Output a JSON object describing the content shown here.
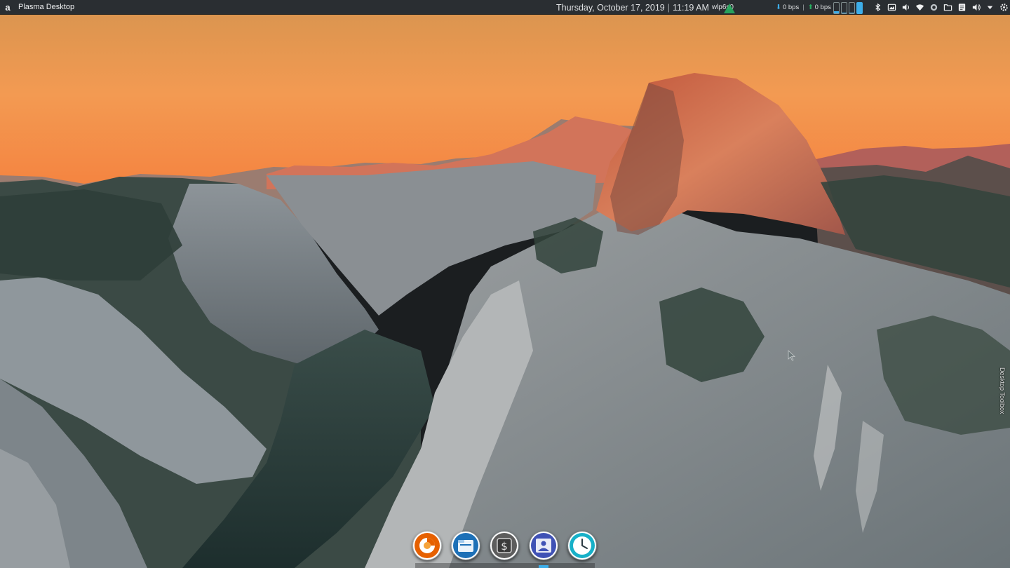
{
  "panel": {
    "launcher_icon": "a",
    "active_window_title": "Plasma Desktop",
    "date": "Thursday, October 17, 2019",
    "time": "11:19 AM",
    "network_name": "wlp6s0",
    "download_speed": "0 bps",
    "upload_speed": "0 bps",
    "tray_icons": [
      "bluetooth-icon",
      "screenshot-icon",
      "volume-icon",
      "wifi-icon",
      "updates-icon",
      "folder-icon",
      "notes-icon",
      "speaker-icon",
      "expand-tray-icon",
      "settings-icon"
    ]
  },
  "desktop": {
    "toolbox_label": "Desktop Toolbox"
  },
  "dock": {
    "apps": [
      {
        "name": "firefox-icon",
        "color": "#e66000"
      },
      {
        "name": "file-manager-icon",
        "color": "#1d70b7"
      },
      {
        "name": "terminal-icon",
        "color": "#5d5d5d"
      },
      {
        "name": "image-viewer-icon",
        "color": "#3f51b5"
      },
      {
        "name": "clock-icon",
        "color": "#17b0c8"
      }
    ]
  },
  "colors": {
    "panel_bg": "#2a2e32",
    "accent": "#3daee9",
    "net_green": "#27ae60"
  }
}
